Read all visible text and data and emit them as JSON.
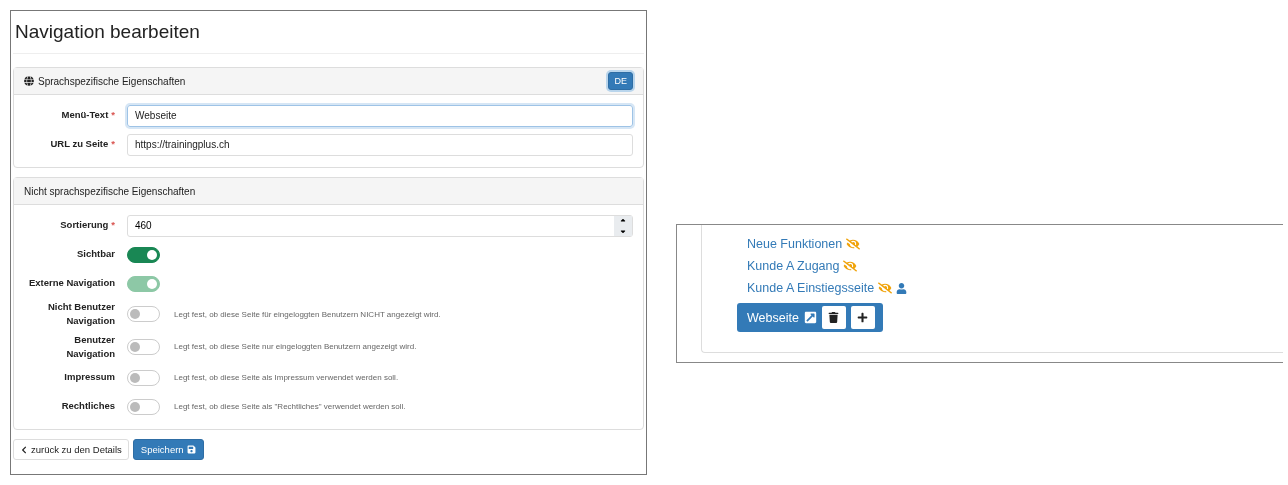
{
  "editor": {
    "title": "Navigation bearbeiten",
    "language_section": {
      "title": "Sprachspezifische Eigenschaften",
      "language_button": "DE",
      "fields": [
        {
          "label": "Menü-Text",
          "required_mark": "*",
          "value": "Webseite",
          "focused": true
        },
        {
          "label": "URL zu Seite",
          "required_mark": "*",
          "value": "https://trainingplus.ch",
          "focused": false
        }
      ]
    },
    "general_section": {
      "title": "Nicht sprachspezifische Eigenschaften",
      "sort_field": {
        "label": "Sortierung",
        "required_mark": "*",
        "value": "460"
      },
      "toggles": [
        {
          "label": "Sichtbar",
          "on": true,
          "disabled": false
        },
        {
          "label": "Externe Navigation",
          "on": true,
          "disabled": true
        },
        {
          "label": "Nicht Benutzer Navigation",
          "on": false,
          "help": "Legt fest, ob diese Seite für eingeloggten Benutzern NICHT angezeigt wird."
        },
        {
          "label": "Benutzer Navigation",
          "on": false,
          "help": "Legt fest, ob diese Seite nur eingeloggten Benutzern angezeigt wird."
        },
        {
          "label": "Impressum",
          "on": false,
          "help": "Legt fest, ob diese Seite als Impressum verwendet werden soll."
        },
        {
          "label": "Rechtliches",
          "on": false,
          "help": "Legt fest, ob diese Seite als \"Rechtliches\" verwendet werden soll."
        }
      ]
    },
    "back_link": "zurück zu den Details",
    "save_button": "Speichern"
  },
  "navigation_tree": {
    "items": [
      {
        "label": "Neue Funktionen",
        "hidden": true,
        "members_only": false,
        "selected": false
      },
      {
        "label": "Kunde A Zugang",
        "hidden": true,
        "members_only": false,
        "selected": false
      },
      {
        "label": "Kunde A Einstiegsseite",
        "hidden": true,
        "members_only": true,
        "selected": false
      },
      {
        "label": "Webseite",
        "selected": true,
        "external": true
      }
    ]
  }
}
